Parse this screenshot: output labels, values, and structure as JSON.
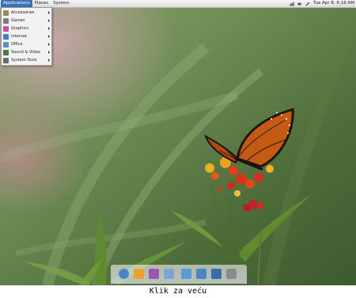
{
  "panel": {
    "menus": [
      "Applications",
      "Places",
      "System"
    ],
    "clock": "Tue Apr 8,  6:16 AM",
    "tray_icons": [
      "network-icon",
      "volume-icon",
      "clipboard-icon"
    ]
  },
  "app_menu": {
    "items": [
      {
        "label": "Accessories",
        "icon": "accessories-icon",
        "color": "#9a8a5a",
        "has_submenu": true
      },
      {
        "label": "Games",
        "icon": "games-icon",
        "color": "#7a7a7a",
        "has_submenu": true
      },
      {
        "label": "Graphics",
        "icon": "graphics-icon",
        "color": "#c94fa6",
        "has_submenu": true
      },
      {
        "label": "Internet",
        "icon": "internet-icon",
        "color": "#3f7ec9",
        "has_submenu": true
      },
      {
        "label": "Office",
        "icon": "office-icon",
        "color": "#5b8fc9",
        "has_submenu": true
      },
      {
        "label": "Sound & Video",
        "icon": "sound-video-icon",
        "color": "#4a7a3a",
        "has_submenu": true
      },
      {
        "label": "System Tools",
        "icon": "system-tools-icon",
        "color": "#6b6b6b",
        "has_submenu": true
      }
    ]
  },
  "dock": {
    "items": [
      {
        "name": "dock-finder",
        "icon": "finder-icon",
        "color": "#4a86c8"
      },
      {
        "name": "dock-user",
        "icon": "user-icon",
        "color": "#f0a030"
      },
      {
        "name": "dock-photos",
        "icon": "photos-icon",
        "color": "#9b55b5"
      },
      {
        "name": "dock-documents",
        "icon": "documents-icon",
        "color": "#7aa8d0"
      },
      {
        "name": "dock-folder",
        "icon": "folder-icon",
        "color": "#5b9bd5"
      },
      {
        "name": "dock-folder-2",
        "icon": "folder-icon",
        "color": "#4a88c2"
      },
      {
        "name": "dock-desktop",
        "icon": "desktop-icon",
        "color": "#3a6aaa"
      },
      {
        "name": "dock-trash",
        "icon": "trash-icon",
        "color": "#8a8a8a"
      }
    ]
  },
  "caption": "Klik za veću"
}
